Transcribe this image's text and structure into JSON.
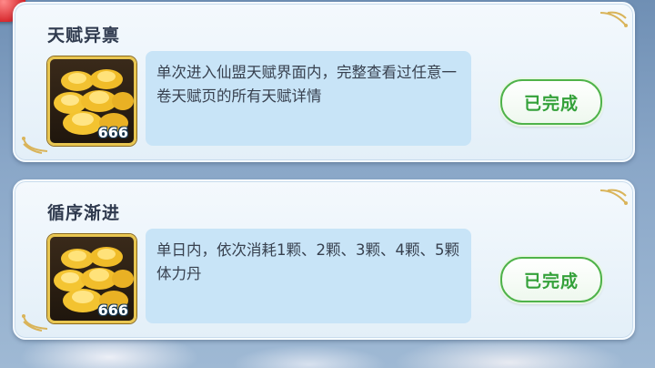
{
  "quests": [
    {
      "title": "天赋异禀",
      "description": "单次进入仙盟天赋界面内，完整查看过任意一卷天赋页的所有天赋详情",
      "reward_icon": "gold-ingots-icon",
      "reward_count": "666",
      "status_label": "已完成"
    },
    {
      "title": "循序渐进",
      "description": "单日内，依次消耗1颗、2颗、3颗、4颗、5颗体力丹",
      "reward_icon": "gold-ingots-icon",
      "reward_count": "666",
      "status_label": "已完成"
    }
  ],
  "colors": {
    "accent_green": "#34a13a",
    "gold_border": "#e8c651",
    "desc_bg": "#c8e4f7"
  }
}
